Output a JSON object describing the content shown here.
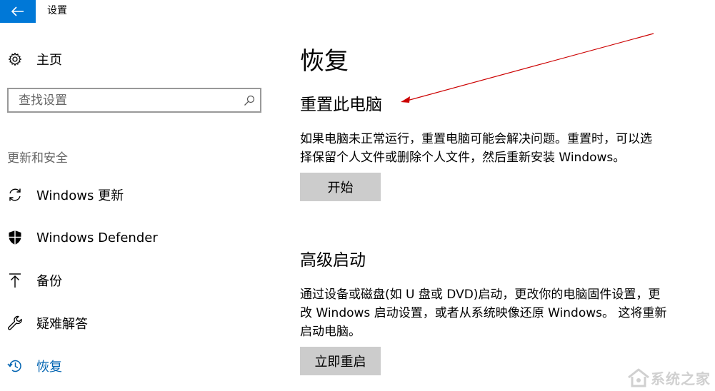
{
  "app": {
    "title": "设置"
  },
  "sidebar": {
    "home_label": "主页",
    "search_placeholder": "查找设置",
    "section_label": "更新和安全",
    "items": [
      {
        "label": "Windows 更新",
        "icon": "refresh-icon"
      },
      {
        "label": "Windows Defender",
        "icon": "shield-icon"
      },
      {
        "label": "备份",
        "icon": "upload-arrow-icon"
      },
      {
        "label": "疑难解答",
        "icon": "wrench-icon"
      },
      {
        "label": "恢复",
        "icon": "history-icon",
        "active": true
      }
    ]
  },
  "main": {
    "title": "恢复",
    "reset": {
      "heading": "重置此电脑",
      "desc_line1": "如果电脑未正常运行，重置电脑可能会解决问题。重置时，可以选",
      "desc_line2": "择保留个人文件或删除个人文件，然后重新安装 Windows。",
      "button": "开始"
    },
    "advanced": {
      "heading": "高级启动",
      "desc_line1": "通过设备或磁盘(如 U 盘或 DVD)启动，更改你的电脑固件设置，更",
      "desc_line2": "改 Windows 启动设置，或者从系统映像还原 Windows。  这将重新",
      "desc_line3": "启动电脑。",
      "button": "立即重启"
    }
  },
  "colors": {
    "accent": "#0078d7",
    "active_text": "#0063b1",
    "button_bg": "#cccccc",
    "annotation_arrow": "#cc0000"
  },
  "watermark": {
    "text": "系统之家"
  }
}
